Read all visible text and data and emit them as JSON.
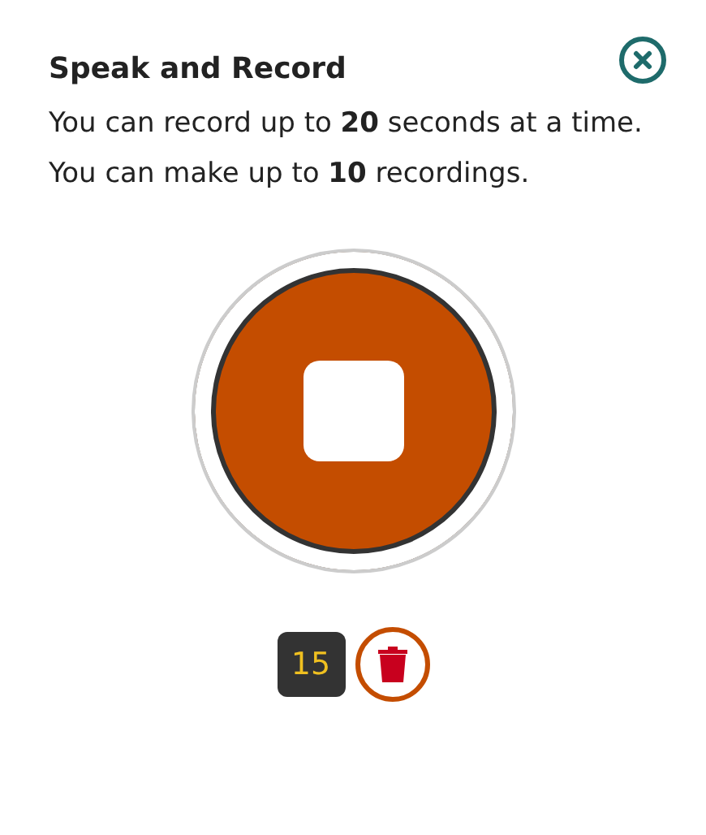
{
  "dialog": {
    "title": "Speak and Record",
    "description": "You can record up to **20** seconds at a time. You can make up to **10** recordings."
  },
  "recorder": {
    "recording": true
  },
  "counter": "15"
}
